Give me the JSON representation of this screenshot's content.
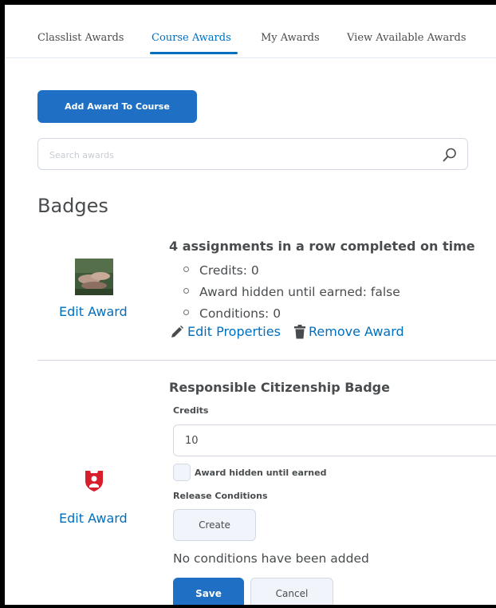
{
  "tabs": [
    {
      "label": "Classlist Awards"
    },
    {
      "label": "Course Awards"
    },
    {
      "label": "My Awards"
    },
    {
      "label": "View Available Awards"
    }
  ],
  "add_button_label": "Add Award To Course",
  "search": {
    "placeholder": "Search awards"
  },
  "section_heading": "Badges",
  "awards": [
    {
      "edit_label": "Edit Award",
      "title": "4 assignments in a row completed on time",
      "properties": [
        "Credits: 0",
        "Award hidden until earned: false",
        "Conditions: 0"
      ],
      "edit_properties_label": "Edit Properties",
      "remove_label": "Remove Award"
    },
    {
      "edit_label": "Edit Award",
      "title": "Responsible Citizenship Badge",
      "credits_label": "Credits",
      "credits_value": "10",
      "hidden_checkbox_label": "Award hidden until earned",
      "release_conditions_label": "Release Conditions",
      "create_label": "Create",
      "no_conditions_text": "No conditions have been added",
      "save_label": "Save",
      "cancel_label": "Cancel"
    }
  ],
  "colors": {
    "accent": "#006fbf",
    "primary_button": "#1f6fc5",
    "badge_red": "#d81e2c"
  }
}
